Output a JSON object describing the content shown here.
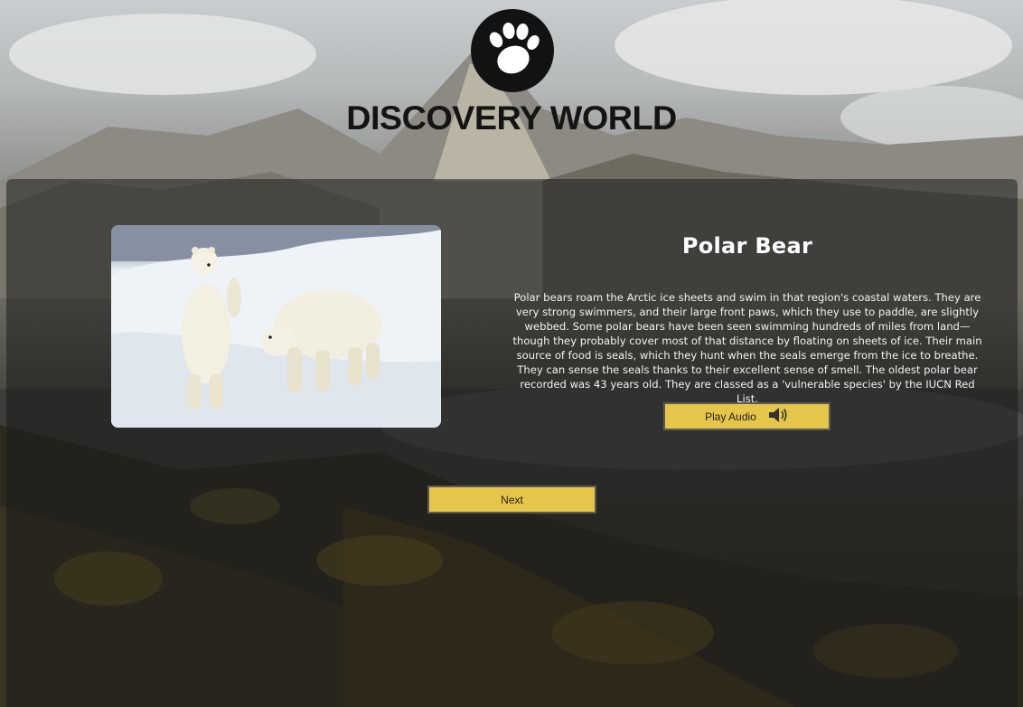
{
  "brand": {
    "name": "DISCOVERY WORLD",
    "logo_icon": "paw-icon"
  },
  "animal": {
    "name": "Polar Bear",
    "image_alt": "Two polar bears on snow and ice",
    "description": "Polar bears roam the Arctic ice sheets and swim in that region's coastal waters. They are very strong swimmers, and their large front paws, which they use to paddle, are slightly webbed. Some polar bears have been seen swimming hundreds of miles from land—though they probably cover most of that distance by floating on sheets of ice. Their main source of food is seals, which they hunt when the seals emerge from the ice to breathe. They can sense the seals thanks to their excellent sense of smell. The oldest polar bear recorded was 43 years old. They are classed as a 'vulnerable species' by the IUCN Red List."
  },
  "controls": {
    "play_audio_label": "Play Audio",
    "play_audio_icon": "speaker-icon",
    "next_label": "Next"
  },
  "colors": {
    "button": "#e6c64a",
    "panel": "rgba(25,25,25,0.52)",
    "title_text": "#ffffff"
  }
}
